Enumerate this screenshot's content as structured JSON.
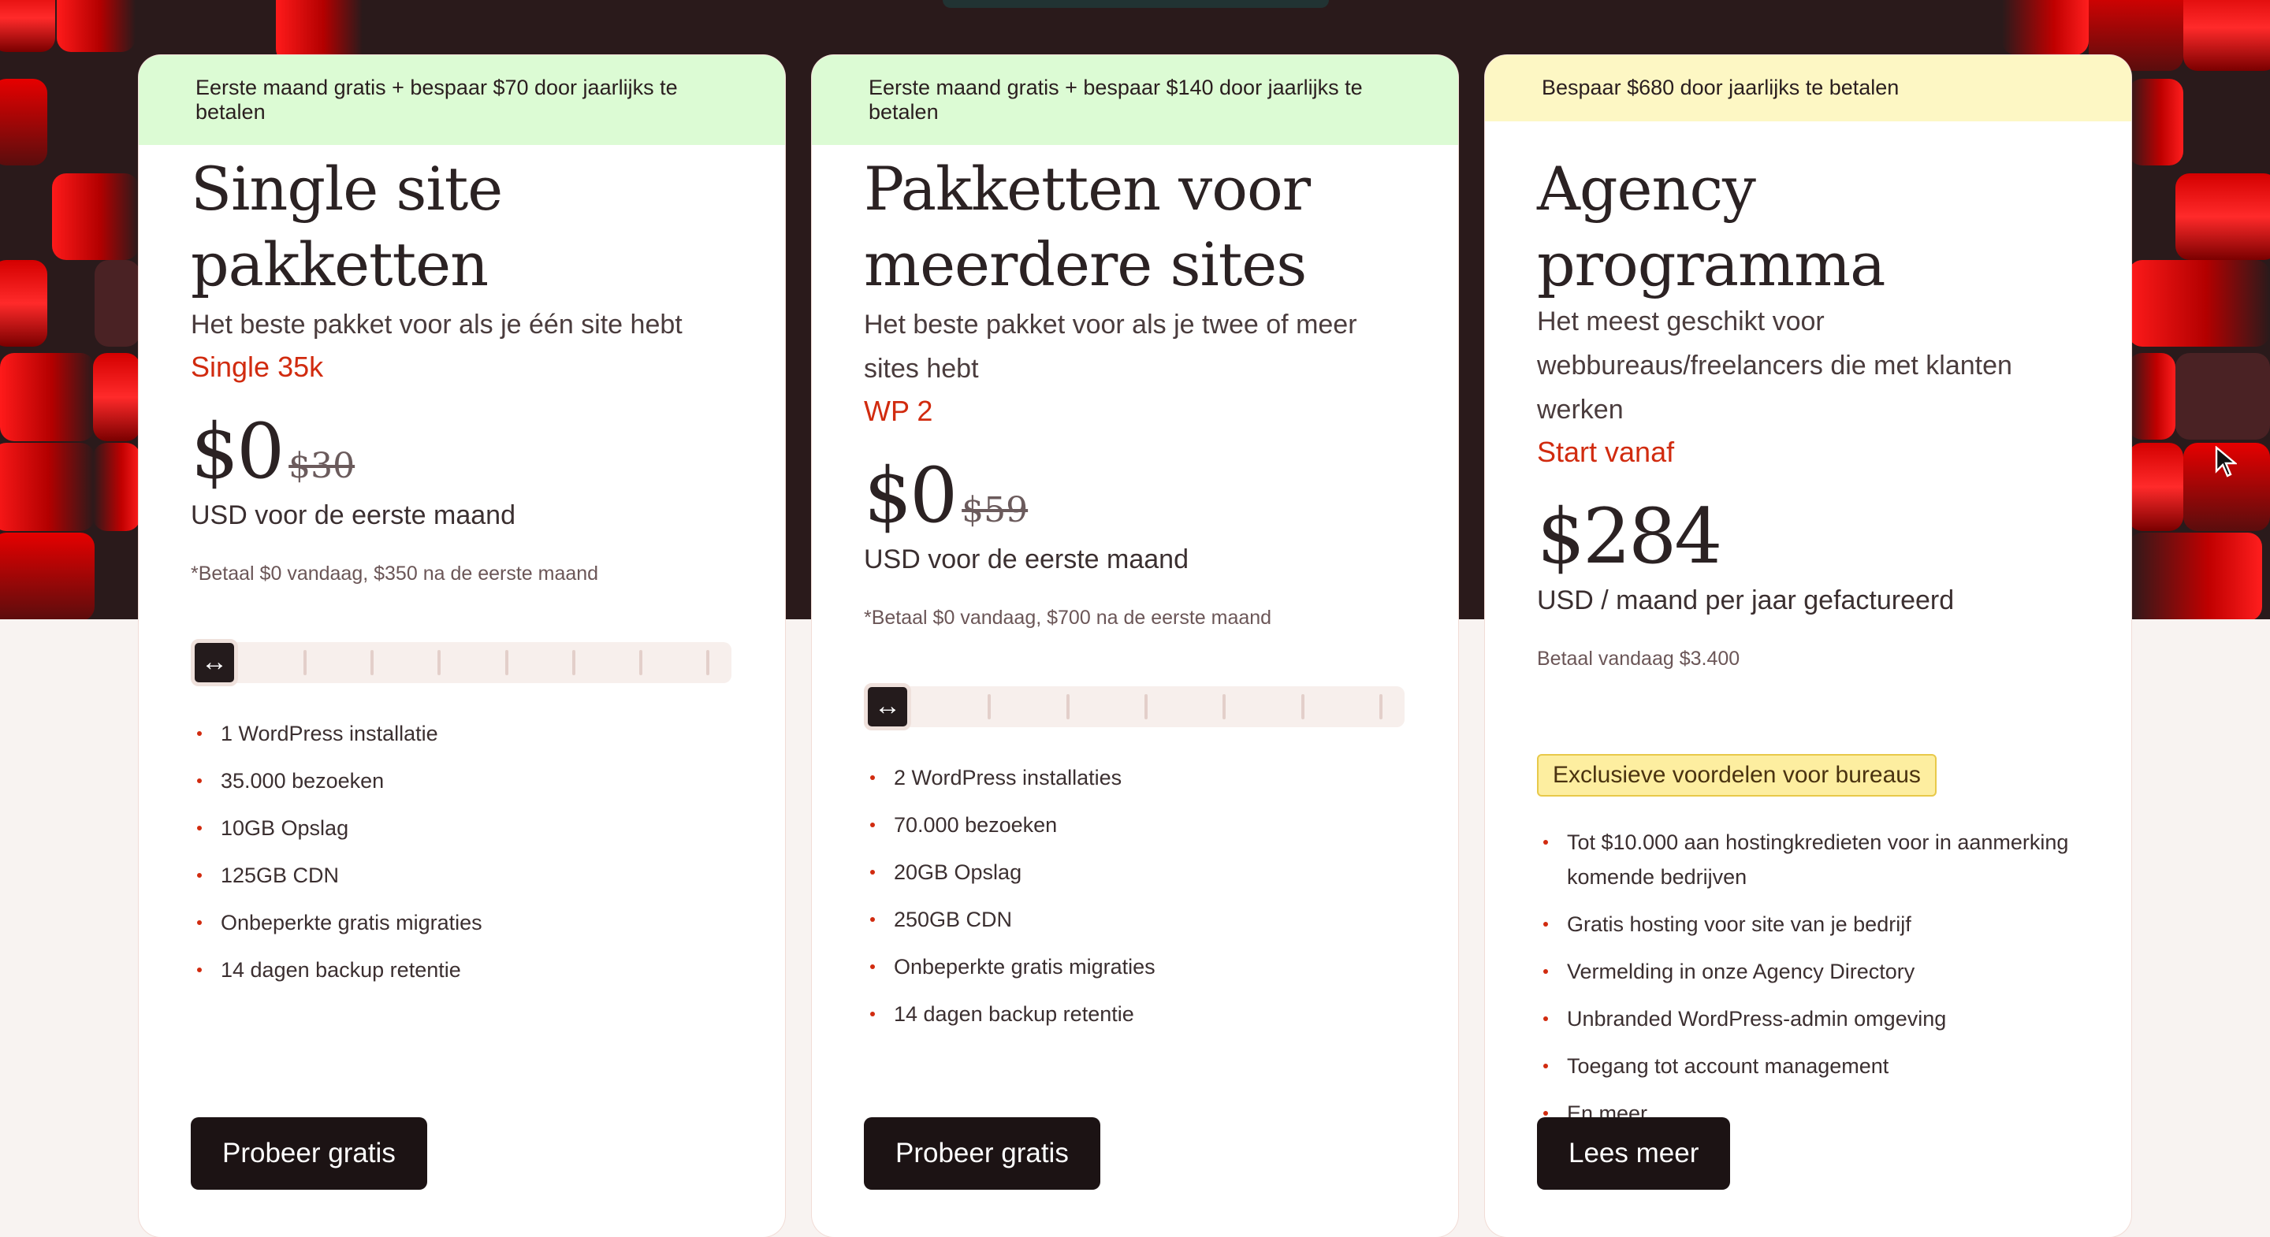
{
  "cards": [
    {
      "banner": "Eerste maand gratis + bespaar $70 door jaarlijks te betalen",
      "title": "Single site pakketten",
      "subtitle": "Het beste pakket voor als je één site hebt",
      "plan_name": "Single 35k",
      "price": "$0",
      "old_price": "$30",
      "price_unit": "USD voor de eerste maand",
      "price_note": "*Betaal $0 vandaag, $350 na de eerste maand",
      "slider_level": 0,
      "features": [
        "1 WordPress installatie",
        "35.000 bezoeken",
        "10GB Opslag",
        "125GB CDN",
        "Onbeperkte gratis migraties",
        "14 dagen backup retentie"
      ],
      "cta": "Probeer gratis"
    },
    {
      "banner": "Eerste maand gratis + bespaar $140 door jaarlijks te betalen",
      "title": "Pakketten voor meerdere sites",
      "subtitle": "Het beste pakket voor als je twee of meer sites hebt",
      "plan_name": "WP 2",
      "price": "$0",
      "old_price": "$59",
      "price_unit": "USD voor de eerste maand",
      "price_note": "*Betaal $0 vandaag, $700 na de eerste maand",
      "slider_level": 0,
      "features": [
        "2 WordPress installaties",
        "70.000 bezoeken",
        "20GB Opslag",
        "250GB CDN",
        "Onbeperkte gratis migraties",
        "14 dagen backup retentie"
      ],
      "cta": "Probeer gratis"
    },
    {
      "banner": "Bespaar $680 door jaarlijks te betalen",
      "title": "Agency programma",
      "subtitle": "Het meest geschikt voor webbureaus/freelancers die met klanten werken",
      "plan_name": "Start vanaf",
      "price": "$284",
      "price_unit": "USD / maand per jaar gefactureerd",
      "price_note": "Betaal vandaag $3.400",
      "badge": "Exclusieve voordelen voor bureaus",
      "features": [
        "Tot $10.000 aan hostingkredieten voor in aanmerking komende bedrijven",
        "Gratis hosting voor site van je bedrijf",
        "Vermelding in onze Agency Directory",
        "Unbranded WordPress-admin omgeving",
        "Toegang tot account management",
        "En meer..."
      ],
      "cta": "Lees meer"
    }
  ],
  "icons": {
    "slider_handle": "resize-horizontal-icon",
    "cursor": "mouse-pointer-icon"
  },
  "colors": {
    "accent": "#d12b0f",
    "banner_green": "#dcfbd4",
    "banner_yellow": "#fdf7c4",
    "cta_bg": "#1c1314"
  }
}
